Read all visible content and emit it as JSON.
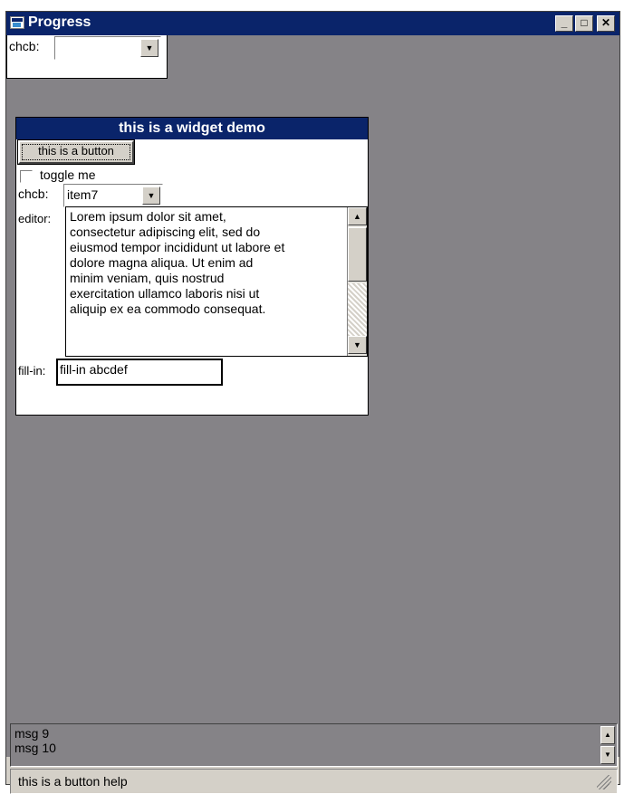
{
  "window": {
    "title": "Progress"
  },
  "caption_buttons": {
    "minimize": "_",
    "maximize": "□",
    "close": "✕"
  },
  "top_combo": {
    "label": "chcb:",
    "value": ""
  },
  "panel": {
    "title": "this is a widget demo",
    "button_label": "this is a button",
    "checkbox_label": "toggle me",
    "checkbox_checked": false,
    "combo_label": "chcb:",
    "combo_value": "item7",
    "editor_label": "editor:",
    "editor_text": "Lorem ipsum dolor sit amet,\nconsectetur adipiscing elit, sed do\neiusmod tempor incididunt ut labore et\ndolore magna aliqua. Ut enim ad\nminim veniam, quis nostrud\nexercitation ullamco laboris nisi ut\naliquip ex ea commodo consequat.",
    "fillin_label": "fill-in:",
    "fillin_value": "fill-in abcdef"
  },
  "messages": [
    "msg 9",
    "msg 10"
  ],
  "status": {
    "text": "this is a button help"
  },
  "icons": {
    "app": "app-window-icon",
    "dropdown": "chevron-down-icon",
    "scroll_up": "scroll-up-icon",
    "scroll_down": "scroll-down-icon",
    "resize": "resize-grip-icon"
  },
  "colors": {
    "titlebar": "#0a246a",
    "client": "#858387",
    "face": "#d4d0c8"
  }
}
